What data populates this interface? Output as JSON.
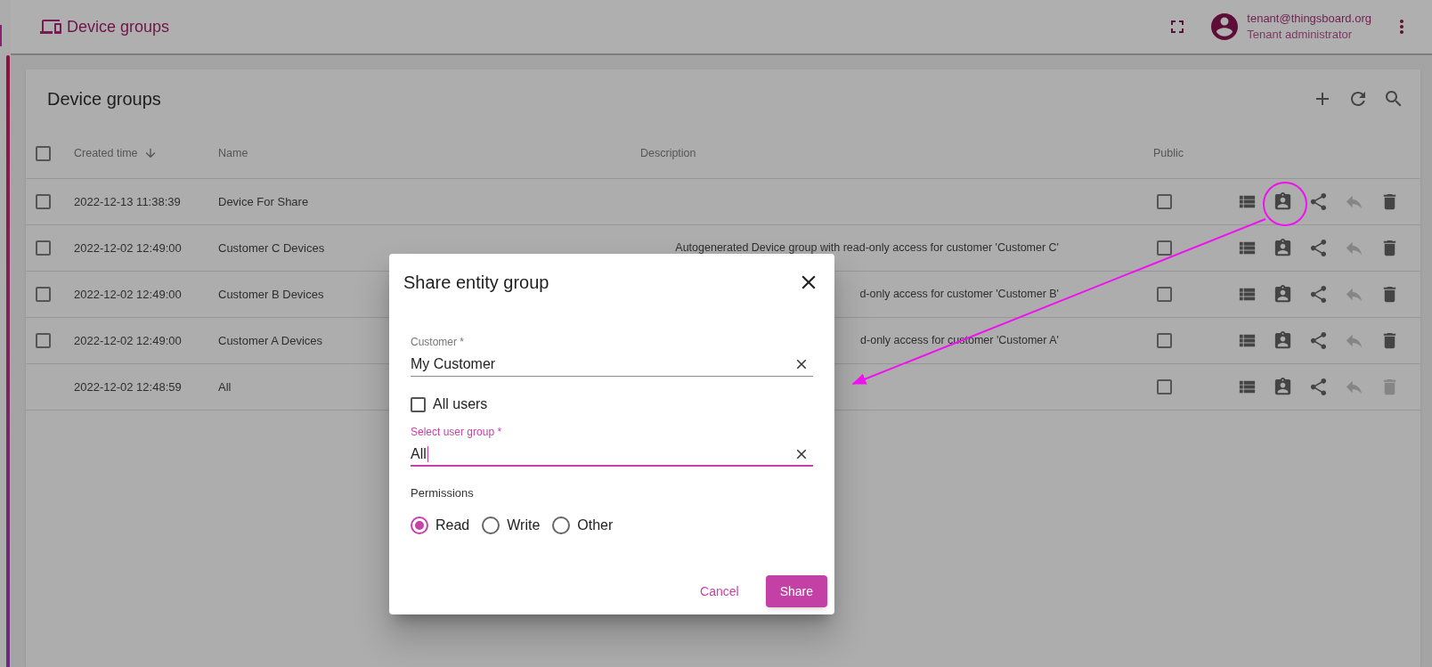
{
  "header": {
    "title": "Device groups",
    "user_email": "tenant@thingsboard.org",
    "user_role": "Tenant administrator"
  },
  "card": {
    "title": "Device groups"
  },
  "table": {
    "all_checked": false,
    "columns": [
      {
        "label": "Created time",
        "sorted": true
      },
      {
        "label": "Name",
        "sorted": false
      },
      {
        "label": "Description",
        "sorted": false
      },
      {
        "label": "Public",
        "sorted": false
      }
    ],
    "rows": [
      {
        "created_time": "2022-12-13 11:38:39",
        "name": "Device For Share",
        "selectable": true,
        "checked": false,
        "public": false,
        "delete_disabled": false,
        "reply_disabled": true
      },
      {
        "created_time": "2022-12-02 12:49:00",
        "name": "Customer C Devices",
        "description": "Autogenerated Device group with read-only access for customer 'Customer C'",
        "selectable": true,
        "checked": false,
        "public": false,
        "delete_disabled": false,
        "reply_disabled": true
      },
      {
        "created_time": "2022-12-02 12:49:00",
        "name": "Customer B Devices",
        "description": "d-only access for customer 'Customer B'",
        "selectable": true,
        "checked": false,
        "public": false,
        "delete_disabled": false,
        "reply_disabled": true
      },
      {
        "created_time": "2022-12-02 12:49:00",
        "name": "Customer A Devices",
        "description": "d-only access for customer 'Customer A'",
        "selectable": true,
        "checked": false,
        "public": false,
        "delete_disabled": false,
        "reply_disabled": true
      },
      {
        "created_time": "2022-12-02 12:48:59",
        "name": "All",
        "selectable": false,
        "public": false,
        "delete_disabled": true,
        "reply_disabled": true
      }
    ]
  },
  "dialog": {
    "title": "Share entity group",
    "customer": {
      "label": "Customer *",
      "value": "My Customer",
      "focused": false
    },
    "all_users": {
      "label": "All users",
      "checked": false
    },
    "user_group": {
      "label": "Select user group *",
      "value": "All",
      "focused": true
    },
    "permissions": {
      "label": "Permissions",
      "options": [
        {
          "label": "Read",
          "selected": true
        },
        {
          "label": "Write",
          "selected": false
        },
        {
          "label": "Other",
          "selected": false
        }
      ]
    },
    "cancel": "Cancel",
    "share": "Share"
  }
}
